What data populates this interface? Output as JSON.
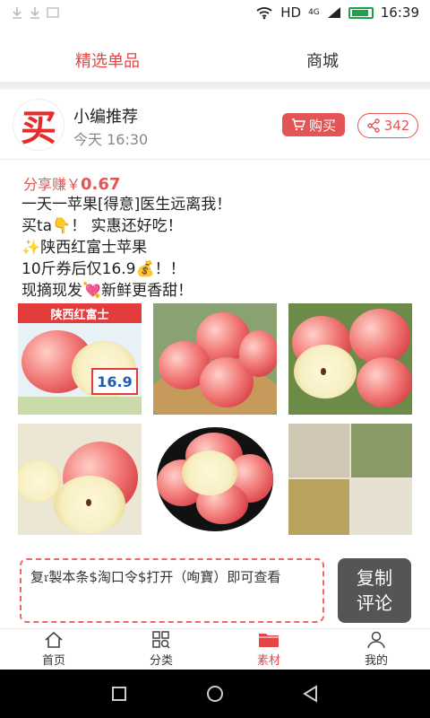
{
  "status_bar": {
    "network": "HD",
    "signal_gen": "4G",
    "time": "16:39"
  },
  "tabs": [
    {
      "label": "精选单品",
      "active": true
    },
    {
      "label": "商城",
      "active": false
    }
  ],
  "post": {
    "avatar_char": "买",
    "author": "小编推荐",
    "time": "今天 16:30",
    "buy_label": "购买",
    "share_count": "342",
    "earn_label": "分享赚￥",
    "earn_amount": "0.67",
    "lines": [
      "一天一苹果[得意]医生远离我！",
      "买ta👇！ 实惠还好吃！",
      "✨陕西红富士苹果",
      "10斤券后仅16.9💰！！",
      "现摘现发💘新鲜更香甜！"
    ],
    "image1_banner": "陕西红富士",
    "image1_price": "16.9"
  },
  "command": {
    "text": "复𝔯製本条$淘口令$打开（咰寶）即可查看",
    "copy_label_line1": "复制",
    "copy_label_line2": "评论"
  },
  "bottom_nav": [
    {
      "label": "首页",
      "icon": "home-icon",
      "active": false
    },
    {
      "label": "分类",
      "icon": "grid-search-icon",
      "active": false
    },
    {
      "label": "素材",
      "icon": "folder-icon",
      "active": true
    },
    {
      "label": "我的",
      "icon": "person-icon",
      "active": false
    }
  ],
  "colors": {
    "accent": "#e64545",
    "button_dark": "#555555"
  }
}
